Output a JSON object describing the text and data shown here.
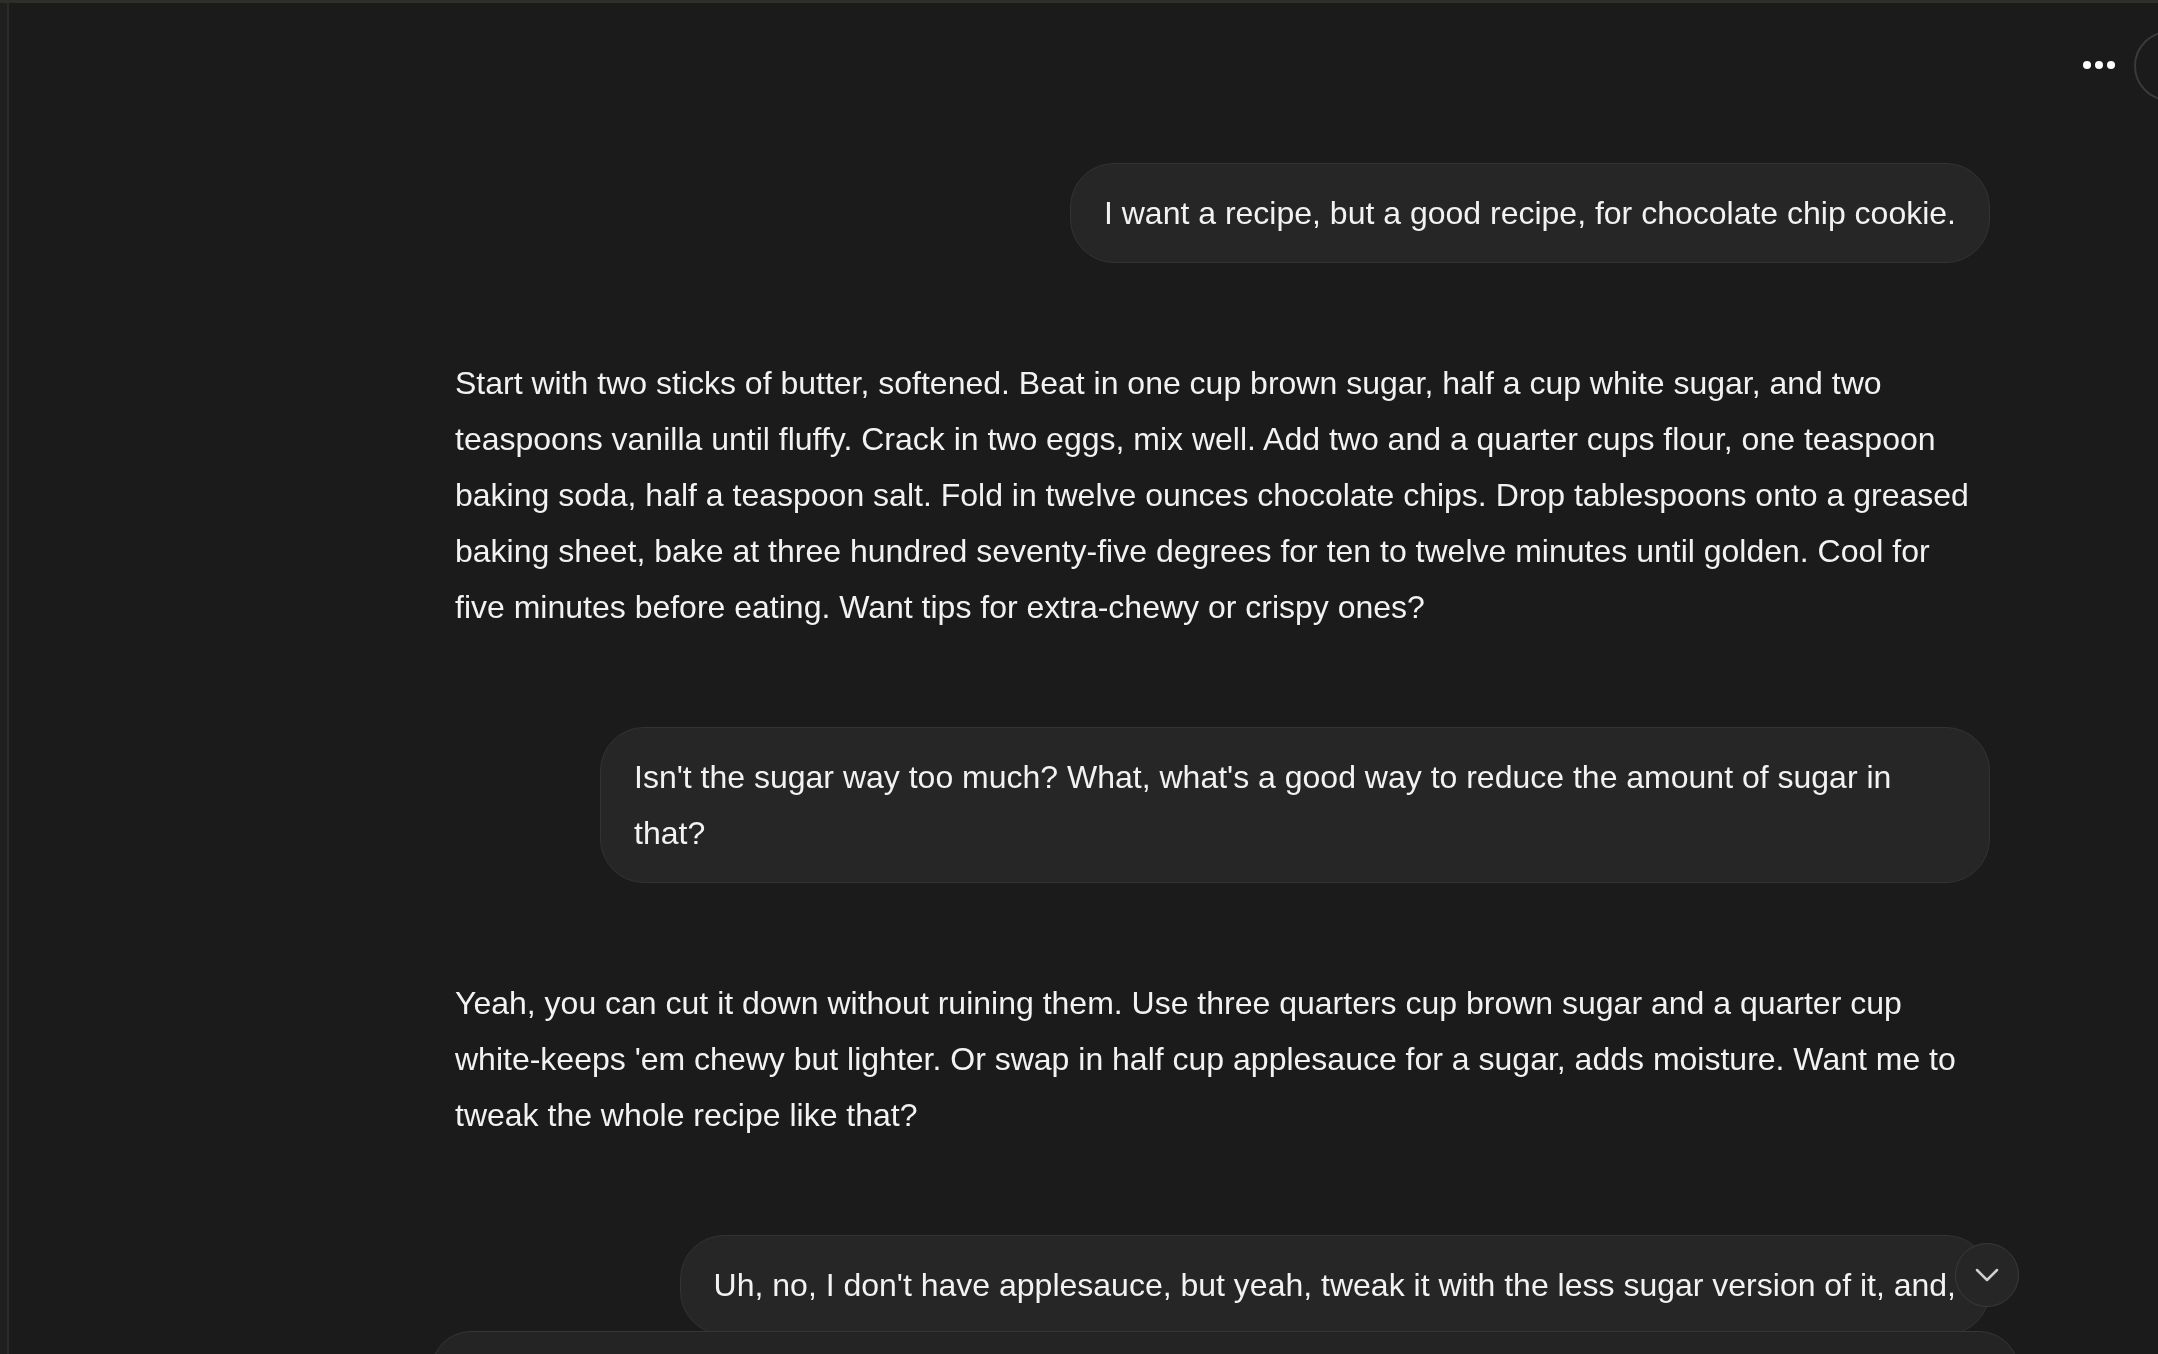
{
  "messages": [
    {
      "kind": "user",
      "text": "I want a recipe, but a good recipe, for chocolate chip cookie."
    },
    {
      "kind": "assistant",
      "text": "Start with two sticks of butter, softened. Beat in one cup brown sugar, half a cup white sugar, and two teaspoons vanilla until fluffy. Crack in two eggs, mix well. Add two and a quarter cups flour, one teaspoon baking soda, half a teaspoon salt. Fold in twelve ounces chocolate chips. Drop tablespoons onto a greased baking sheet, bake at three hundred seventy-five degrees for ten to twelve minutes until golden. Cool for five minutes before eating. Want tips for extra-chewy or crispy ones?"
    },
    {
      "kind": "user",
      "text": "Isn't the sugar way too much? What, what's a good way to reduce the amount of sugar in that?"
    },
    {
      "kind": "assistant",
      "text": "Yeah, you can cut it down without ruining them. Use three quarters cup brown sugar and a quarter cup white-keeps 'em chewy but lighter. Or swap in half cup applesauce for a sugar, adds moisture. Want me to tweak the whole recipe like that?"
    },
    {
      "kind": "user",
      "text": "Uh, no, I don't have applesauce, but yeah, tweak it with the less sugar version of it, and,"
    }
  ]
}
